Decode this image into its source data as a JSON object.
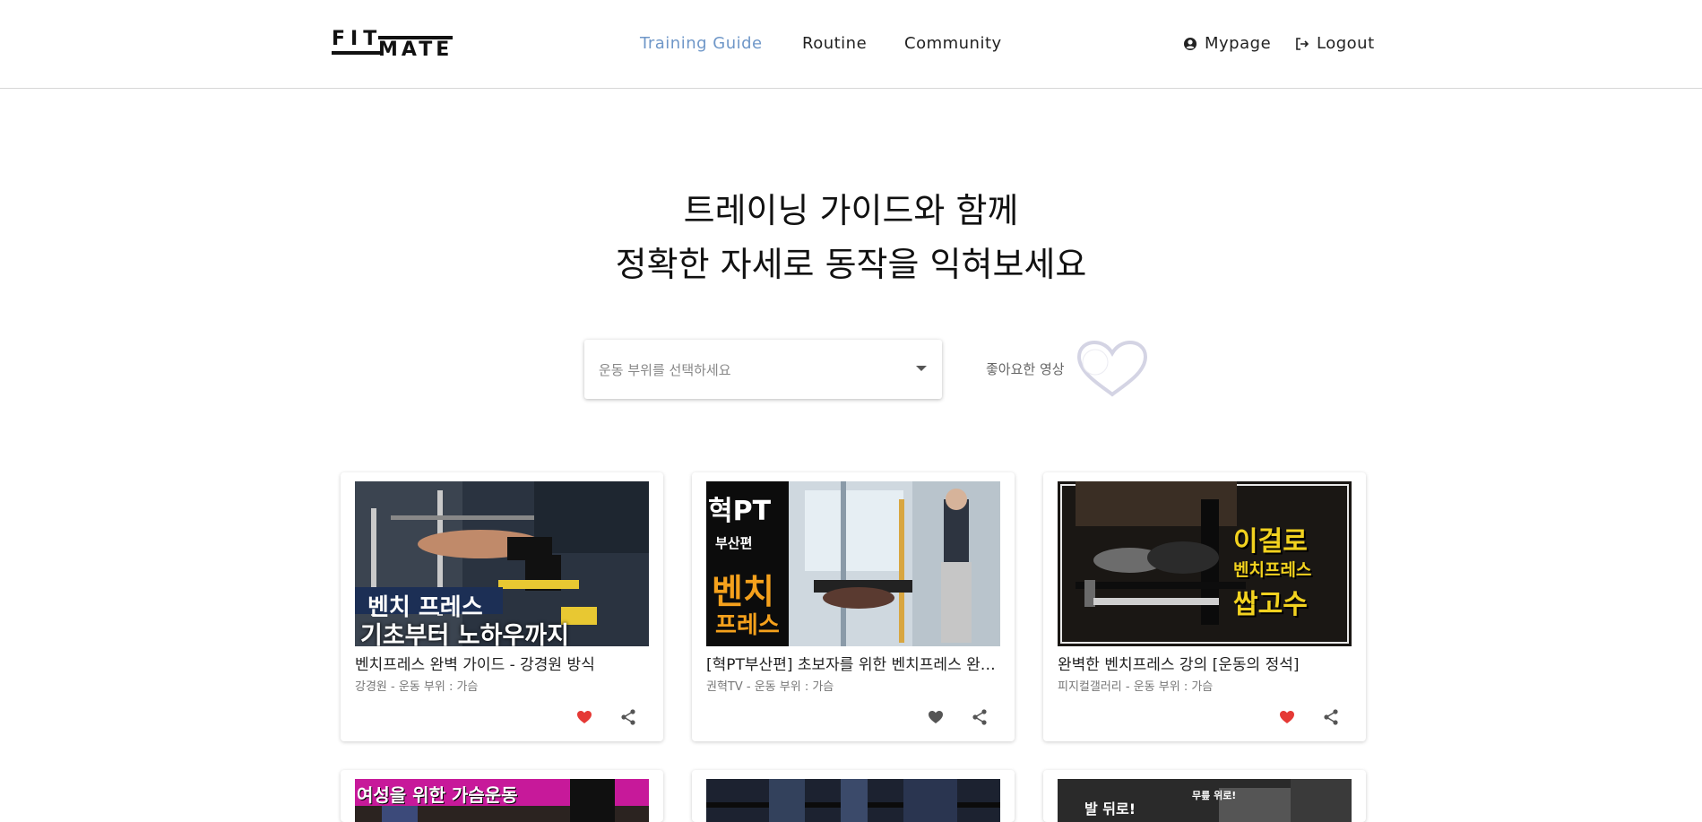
{
  "header": {
    "logo_top": "FIT",
    "logo_bottom": "MATE",
    "nav": [
      {
        "label": "Training Guide",
        "active": true
      },
      {
        "label": "Routine",
        "active": false
      },
      {
        "label": "Community",
        "active": false
      }
    ],
    "mypage_label": "Mypage",
    "logout_label": "Logout",
    "accent_color": "#6f97c8"
  },
  "hero": {
    "line1": "트레이닝 가이드와 함께",
    "line2": "정확한 자세로 동작을 익혀보세요"
  },
  "filter": {
    "placeholder": "운동 부위를 선택하세요",
    "liked_label": "좋아요한 영상",
    "liked_toggle_on": false
  },
  "cards": [
    {
      "thumb_text_line1": "벤치 프레스",
      "thumb_text_line2": "기초부터 노하우까지",
      "title": "벤치프레스 완벽 가이드 - 강경원 방식",
      "meta": "강경원 - 운동 부위 : 가슴",
      "liked": true
    },
    {
      "thumb_text_line1": "혁PT",
      "thumb_text_line2": "부산편",
      "thumb_text_line3": "벤치",
      "thumb_text_line4": "프레스",
      "title": "[혁PT부산편] 초보자를 위한 벤치프레스 완벽 가이드",
      "meta": "권혁TV - 운동 부위 : 가슴",
      "liked": false
    },
    {
      "thumb_text_line1": "이걸로",
      "thumb_text_line2": "벤치프레스",
      "thumb_text_line3": "쌉고수",
      "title": "완벽한 벤치프레스 강의 [운동의 정석]",
      "meta": "피지컬갤러리 - 운동 부위 : 가슴",
      "liked": true
    },
    {
      "thumb_text_line1": "여성을 위한 가슴운동"
    },
    {},
    {
      "thumb_text_line1": "발 뒤로!",
      "thumb_text_line2": "무릎 위로!"
    }
  ],
  "colors": {
    "liked": "#e53935",
    "unliked": "#555555"
  }
}
